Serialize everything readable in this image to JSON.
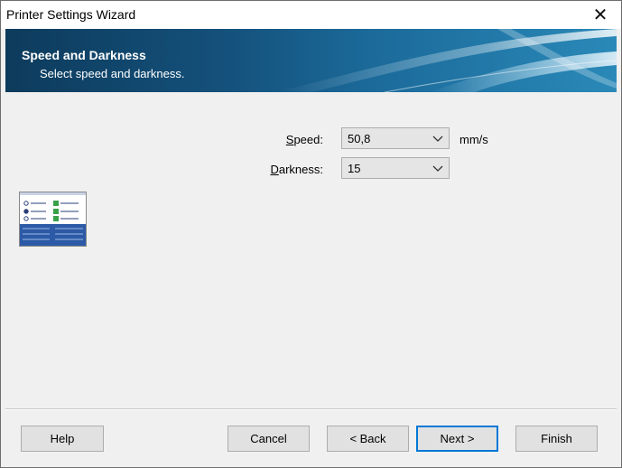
{
  "window": {
    "title": "Printer Settings Wizard",
    "close_glyph": "✕"
  },
  "banner": {
    "title": "Speed and Darkness",
    "subtitle": "Select speed and darkness."
  },
  "form": {
    "speed": {
      "label_accel": "S",
      "label_rest": "peed:",
      "value": "50,8",
      "unit": "mm/s"
    },
    "darkness": {
      "label_accel": "D",
      "label_rest": "arkness:",
      "value": "15"
    }
  },
  "buttons": {
    "help": "Help",
    "cancel": "Cancel",
    "back": "< Back",
    "next": "Next >",
    "finish": "Finish"
  },
  "icons": {
    "close": "close-icon",
    "dropdown": "chevron-down-icon",
    "illustration": "settings-checklist-icon"
  },
  "colors": {
    "banner_dark": "#0d3b5c",
    "banner_light": "#2a89b8",
    "default_button_border": "#0078d7",
    "checkbox_green": "#3aa04a"
  }
}
